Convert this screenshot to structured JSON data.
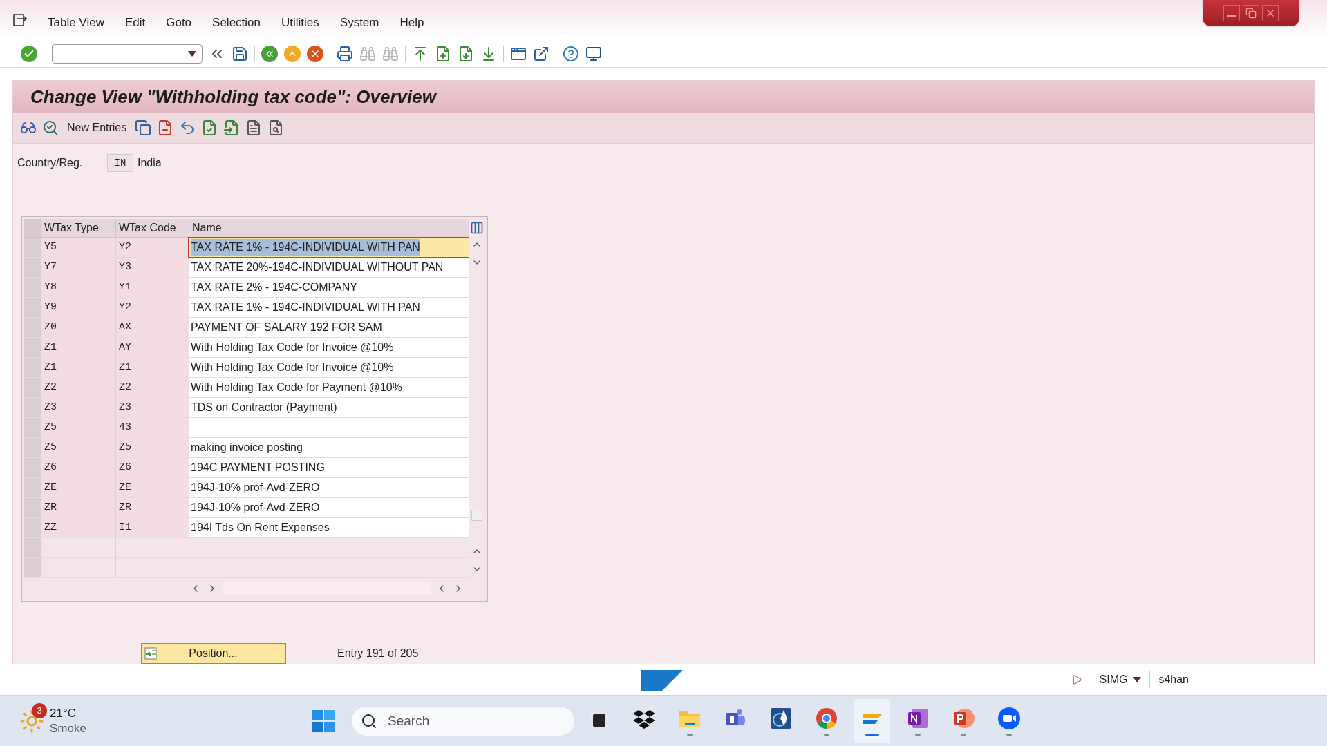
{
  "menu": [
    "Table View",
    "Edit",
    "Goto",
    "Selection",
    "Utilities",
    "System",
    "Help"
  ],
  "title": "Change View \"Withholding tax code\": Overview",
  "app_toolbar": {
    "new_entries": "New Entries"
  },
  "country": {
    "label": "Country/Reg.",
    "value": "IN",
    "text": "India"
  },
  "table": {
    "columns": [
      "WTax Type",
      "WTax Code",
      "Name"
    ],
    "rows": [
      {
        "type": "Y5",
        "code": "Y2",
        "name": "TAX RATE 1% - 194C-INDIVIDUAL WITH PAN",
        "selected": true
      },
      {
        "type": "Y7",
        "code": "Y3",
        "name": "TAX RATE 20%-194C-INDIVIDUAL WITHOUT PAN",
        "selected": false
      },
      {
        "type": "Y8",
        "code": "Y1",
        "name": "TAX RATE 2% - 194C-COMPANY",
        "selected": false
      },
      {
        "type": "Y9",
        "code": "Y2",
        "name": "TAX RATE 1% - 194C-INDIVIDUAL WITH PAN",
        "selected": false
      },
      {
        "type": "Z0",
        "code": "AX",
        "name": "PAYMENT OF SALARY 192 FOR SAM",
        "selected": false
      },
      {
        "type": "Z1",
        "code": "AY",
        "name": "With Holding Tax Code for Invoice @10%",
        "selected": false
      },
      {
        "type": "Z1",
        "code": "Z1",
        "name": "With Holding Tax Code for Invoice @10%",
        "selected": false
      },
      {
        "type": "Z2",
        "code": "Z2",
        "name": "With Holding Tax Code for Payment @10%",
        "selected": false
      },
      {
        "type": "Z3",
        "code": "Z3",
        "name": "TDS on Contractor (Payment)",
        "selected": false
      },
      {
        "type": "Z5",
        "code": "43",
        "selected": false
      },
      {
        "type": "Z5",
        "code": "Z5",
        "name": "making invoice posting",
        "selected": false
      },
      {
        "type": "Z6",
        "code": "Z6",
        "name": "194C PAYMENT POSTING",
        "selected": false
      },
      {
        "type": "ZE",
        "code": "ZE",
        "name": "194J-10% prof-Avd-ZERO",
        "selected": false
      },
      {
        "type": "ZR",
        "code": "ZR",
        "name": "194J-10% prof-Avd-ZERO",
        "selected": false
      },
      {
        "type": "ZZ",
        "code": "I1",
        "name": "194I Tds On Rent Expenses",
        "selected": false
      }
    ]
  },
  "position_button": "Position...",
  "entry_info": "Entry 191 of 205",
  "status_bar": {
    "transaction": "SIMG",
    "server": "s4han"
  },
  "taskbar": {
    "weather": {
      "temp": "21°C",
      "condition": "Smoke",
      "badge": "3"
    },
    "search": {
      "placeholder": "Search"
    },
    "apps": [
      {
        "kind": "taskview",
        "running": false,
        "selected": false
      },
      {
        "kind": "dropbox",
        "running": false,
        "selected": false
      },
      {
        "kind": "explorer",
        "running": true,
        "selected": false
      },
      {
        "kind": "teams",
        "running": false,
        "selected": false
      },
      {
        "kind": "launcher",
        "running": false,
        "selected": false
      },
      {
        "kind": "chrome",
        "running": true,
        "selected": false
      },
      {
        "kind": "sapgui",
        "running": true,
        "selected": true
      },
      {
        "kind": "onenote",
        "running": true,
        "selected": false
      },
      {
        "kind": "powerpoint",
        "running": true,
        "selected": false
      },
      {
        "kind": "zoom",
        "running": true,
        "selected": false
      }
    ]
  }
}
